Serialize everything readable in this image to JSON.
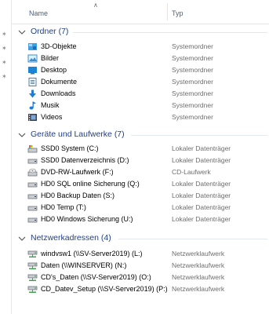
{
  "columns": {
    "name": "Name",
    "type": "Typ"
  },
  "groups": [
    {
      "title": "Ordner (7)",
      "items": [
        {
          "name": "3D-Objekte",
          "type": "Systemordner",
          "icon": "3d-objects-icon"
        },
        {
          "name": "Bilder",
          "type": "Systemordner",
          "icon": "pictures-folder-icon"
        },
        {
          "name": "Desktop",
          "type": "Systemordner",
          "icon": "desktop-folder-icon"
        },
        {
          "name": "Dokumente",
          "type": "Systemordner",
          "icon": "documents-folder-icon"
        },
        {
          "name": "Downloads",
          "type": "Systemordner",
          "icon": "downloads-arrow-icon"
        },
        {
          "name": "Musik",
          "type": "Systemordner",
          "icon": "music-note-icon"
        },
        {
          "name": "Videos",
          "type": "Systemordner",
          "icon": "video-folder-icon"
        }
      ]
    },
    {
      "title": "Geräte und Laufwerke (7)",
      "items": [
        {
          "name": "SSD0 System (C:)",
          "type": "Lokaler Datenträger",
          "icon": "system-drive-icon"
        },
        {
          "name": "SSD0 Datenverzeichnis (D:)",
          "type": "Lokaler Datenträger",
          "icon": "hard-drive-icon"
        },
        {
          "name": "DVD-RW-Laufwerk (F:)",
          "type": "CD-Laufwerk",
          "icon": "dvd-drive-icon"
        },
        {
          "name": "HD0 SQL online Sicherung (Q:)",
          "type": "Lokaler Datenträger",
          "icon": "hard-drive-icon"
        },
        {
          "name": "HD0 Backup Daten (S:)",
          "type": "Lokaler Datenträger",
          "icon": "hard-drive-icon"
        },
        {
          "name": "HD0 Temp (T:)",
          "type": "Lokaler Datenträger",
          "icon": "hard-drive-icon"
        },
        {
          "name": "HD0 Windows Sicherung (U:)",
          "type": "Lokaler Datenträger",
          "icon": "hard-drive-icon"
        }
      ]
    },
    {
      "title": "Netzwerkadressen (4)",
      "items": [
        {
          "name": "windvsw1 (\\\\SV-Server2019) (L:)",
          "type": "Netzwerklaufwerk",
          "icon": "network-drive-icon"
        },
        {
          "name": "Daten (\\\\WINSERVER) (N:)",
          "type": "Netzwerklaufwerk",
          "icon": "network-drive-icon"
        },
        {
          "name": "CD's_Daten (\\\\SV-Server2019) (O:)",
          "type": "Netzwerklaufwerk",
          "icon": "network-drive-icon"
        },
        {
          "name": "CD_Datev_Setup (\\\\SV-Server2019) (P:)",
          "type": "Netzwerklaufwerk",
          "icon": "network-drive-icon"
        }
      ]
    }
  ]
}
